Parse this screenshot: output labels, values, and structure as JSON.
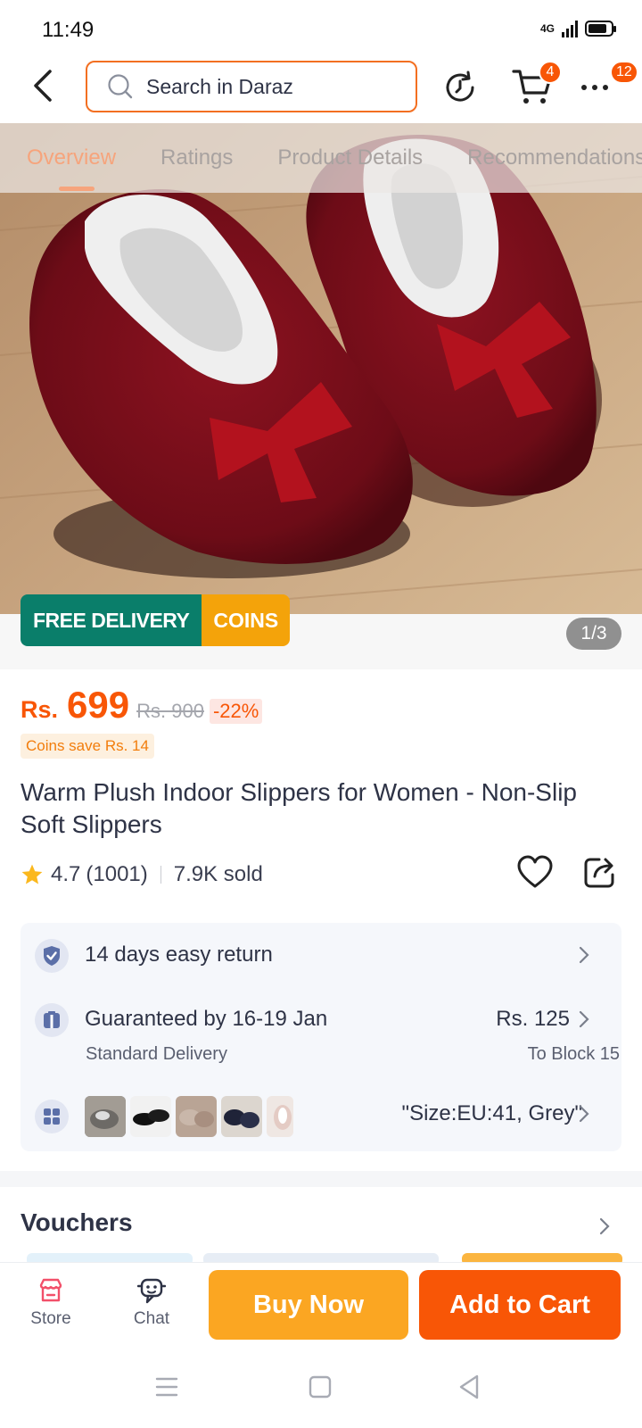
{
  "status_bar": {
    "time": "11:49",
    "network": "4G"
  },
  "header": {
    "search": {
      "placeholder": "Search in Daraz"
    },
    "cart_badge": "4",
    "more_badge": "12"
  },
  "tabs": [
    {
      "label": "Overview",
      "active": true
    },
    {
      "label": "Ratings"
    },
    {
      "label": "Product Details"
    },
    {
      "label": "Recommendations"
    }
  ],
  "gallery": {
    "free_delivery": "FREE DELIVERY",
    "coins": "COINS",
    "pager": "1/3"
  },
  "price": {
    "currency": "Rs.",
    "value": "699",
    "original": "Rs. 900",
    "discount": "-22%",
    "coins_save": "Coins save Rs. 14"
  },
  "product": {
    "title": "Warm Plush Indoor Slippers for Women - Non-Slip Soft Slippers",
    "rating": "4.7",
    "rating_count": "(1001)",
    "sold": "7.9K sold"
  },
  "info": {
    "return": "14 days easy return",
    "delivery_title": "Guaranteed by 16-19 Jan",
    "delivery_sub": "Standard Delivery",
    "delivery_price": "Rs. 125",
    "delivery_to": "To Block 15",
    "variant": "\"Size:EU:41, Grey\""
  },
  "vouchers": {
    "title": "Vouchers"
  },
  "bottom_bar": {
    "store": "Store",
    "chat": "Chat",
    "buy_now": "Buy Now",
    "add_to_cart": "Add to Cart"
  },
  "colors": {
    "accent": "#f85606",
    "buy_now": "#fba622",
    "free_delivery": "#0a7e6a",
    "coins": "#f4a30a"
  }
}
